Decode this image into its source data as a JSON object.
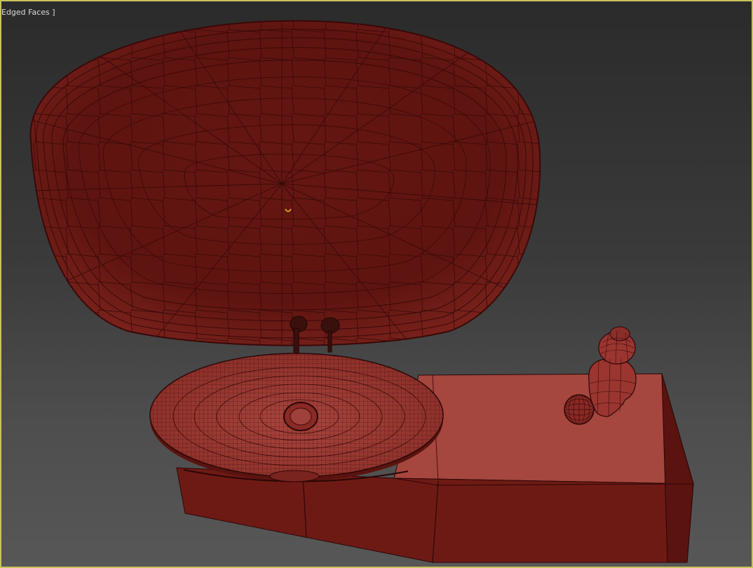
{
  "viewport": {
    "label": "Edged Faces ]",
    "border_color": "#c8c25e",
    "active": true
  },
  "scene": {
    "objects": [
      {
        "name": "oval-mirror",
        "color": "#6a1a16",
        "wire_color": "#3a0b09"
      },
      {
        "name": "wash-basin",
        "color": "#8a2e28"
      },
      {
        "name": "faucet",
        "color": "#3a100c"
      },
      {
        "name": "vanity-cabinet",
        "color_top": "#a5473f",
        "color_front": "#701a14",
        "color_side": "#5e1510"
      },
      {
        "name": "bust-statue",
        "color": "#9a3530"
      },
      {
        "name": "decorative-ball",
        "color": "#8a2a25"
      }
    ],
    "pivot_marker_color": "#e8c020"
  }
}
